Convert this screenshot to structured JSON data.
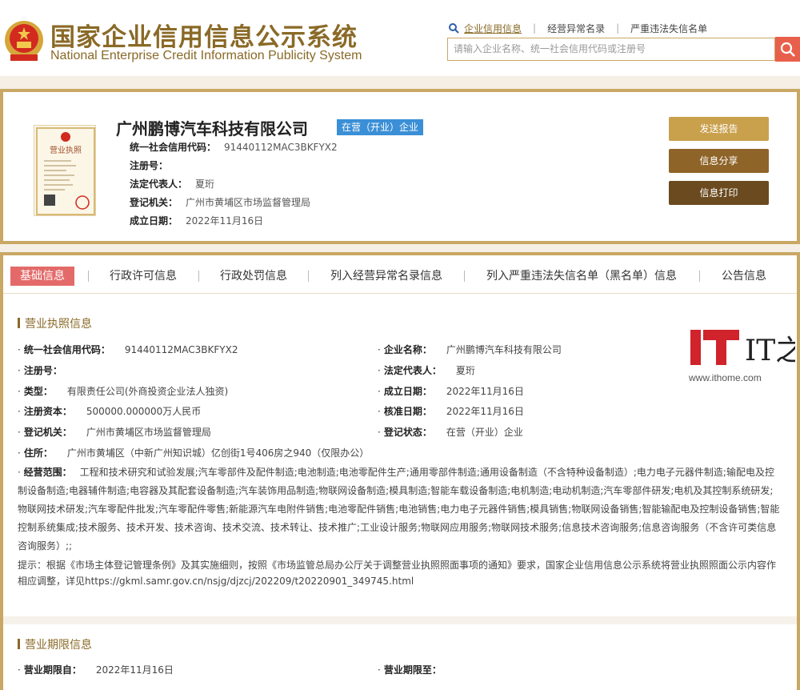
{
  "header": {
    "title": "国家企业信用信息公示系统",
    "subtitle": "National Enterprise Credit Information Publicity System",
    "search_tabs": [
      "企业信用信息",
      "经营异常名录",
      "严重违法失信名单"
    ],
    "search_placeholder": "请输入企业名称、统一社会信用代码或注册号"
  },
  "company": {
    "name": "广州鹏博汽车科技有限公司",
    "status": "在营（开业）企业",
    "license_caption": "营业执照",
    "rows": [
      {
        "label": "统一社会信用代码：",
        "value": "91440112MAC3BKFYX2"
      },
      {
        "label": "注册号：",
        "value": ""
      },
      {
        "label": "法定代表人：",
        "value": "夏珩"
      },
      {
        "label": "登记机关：",
        "value": "广州市黄埔区市场监督管理局"
      },
      {
        "label": "成立日期：",
        "value": "2022年11月16日"
      }
    ],
    "actions": [
      "发送报告",
      "信息分享",
      "信息打印"
    ]
  },
  "tabs": [
    "基础信息",
    "行政许可信息",
    "行政处罚信息",
    "列入经营异常名录信息",
    "列入严重违法失信名单（黑名单）信息",
    "公告信息"
  ],
  "license_section": {
    "title": "营业执照信息",
    "fields": [
      {
        "label": "统一社会信用代码：",
        "value": "91440112MAC3BKFYX2"
      },
      {
        "label": "企业名称：",
        "value": "广州鹏博汽车科技有限公司"
      },
      {
        "label": "注册号：",
        "value": ""
      },
      {
        "label": "法定代表人：",
        "value": "夏珩"
      },
      {
        "label": "类型：",
        "value": "有限责任公司(外商投资企业法人独资)"
      },
      {
        "label": "成立日期：",
        "value": "2022年11月16日"
      },
      {
        "label": "注册资本：",
        "value": "500000.000000万人民币"
      },
      {
        "label": "核准日期：",
        "value": "2022年11月16日"
      },
      {
        "label": "登记机关：",
        "value": "广州市黄埔区市场监督管理局"
      },
      {
        "label": "登记状态：",
        "value": "在营（开业）企业"
      },
      {
        "label": "住所：",
        "value": "广州市黄埔区（中新广州知识城）亿创街1号406房之940（仅限办公）"
      }
    ],
    "scope_label": "经营范围：",
    "scope": "工程和技术研究和试验发展;汽车零部件及配件制造;电池制造;电池零配件生产;通用零部件制造;通用设备制造（不含特种设备制造）;电力电子元器件制造;输配电及控制设备制造;电器辅件制造;电容器及其配套设备制造;汽车装饰用品制造;物联网设备制造;模具制造;智能车载设备制造;电机制造;电动机制造;汽车零部件研发;电机及其控制系统研发;物联网技术研发;汽车零配件批发;汽车零配件零售;新能源汽车电附件销售;电池零配件销售;电池销售;电力电子元器件销售;模具销售;物联网设备销售;智能输配电及控制设备销售;智能控制系统集成;技术服务、技术开发、技术咨询、技术交流、技术转让、技术推广;工业设计服务;物联网应用服务;物联网技术服务;信息技术咨询服务;信息咨询服务（不含许可类信息咨询服务）;;",
    "tip": "提示：根据《市场主体登记管理条例》及其实施细则，按照《市场监管总局办公厅关于调整营业执照照面事项的通知》要求，国家企业信用信息公示系统将营业执照照面公示内容作相应调整，详见https://gkml.samr.gov.cn/nsjg/djzcj/202209/t20220901_349745.html"
  },
  "term_section": {
    "title": "营业期限信息",
    "fields": [
      {
        "label": "营业期限自：",
        "value": "2022年11月16日"
      },
      {
        "label": "营业期限至：",
        "value": ""
      }
    ]
  },
  "watermark": {
    "logo": "IT之家",
    "url": "www.ithome.com"
  },
  "colors": {
    "gold": "#8a6a27",
    "border": "#c9a764",
    "active_tab": "#e46a6a",
    "badge": "#3b8fd6",
    "btn1": "#c9a04c",
    "btn2": "#8f6428",
    "btn3": "#6b4a1f",
    "search_btn": "#e8604c"
  }
}
